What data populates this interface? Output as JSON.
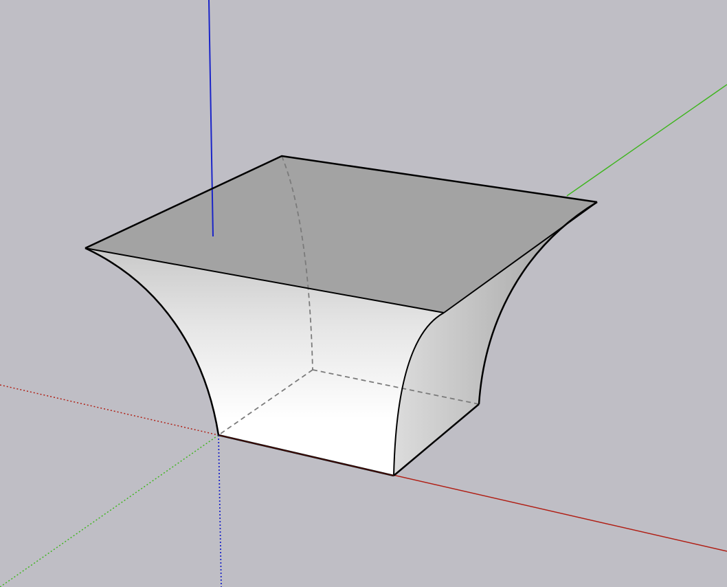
{
  "viewport": {
    "background_color": "#bfbec5"
  },
  "axes": {
    "red_axis_color": "#b01e14",
    "green_axis_color": "#3fb51f",
    "blue_axis_color": "#1a24c8"
  },
  "model": {
    "top_face_color": "#a3a3a3",
    "edge_color": "#000000",
    "hidden_edge_color": "#7a7a7a"
  }
}
